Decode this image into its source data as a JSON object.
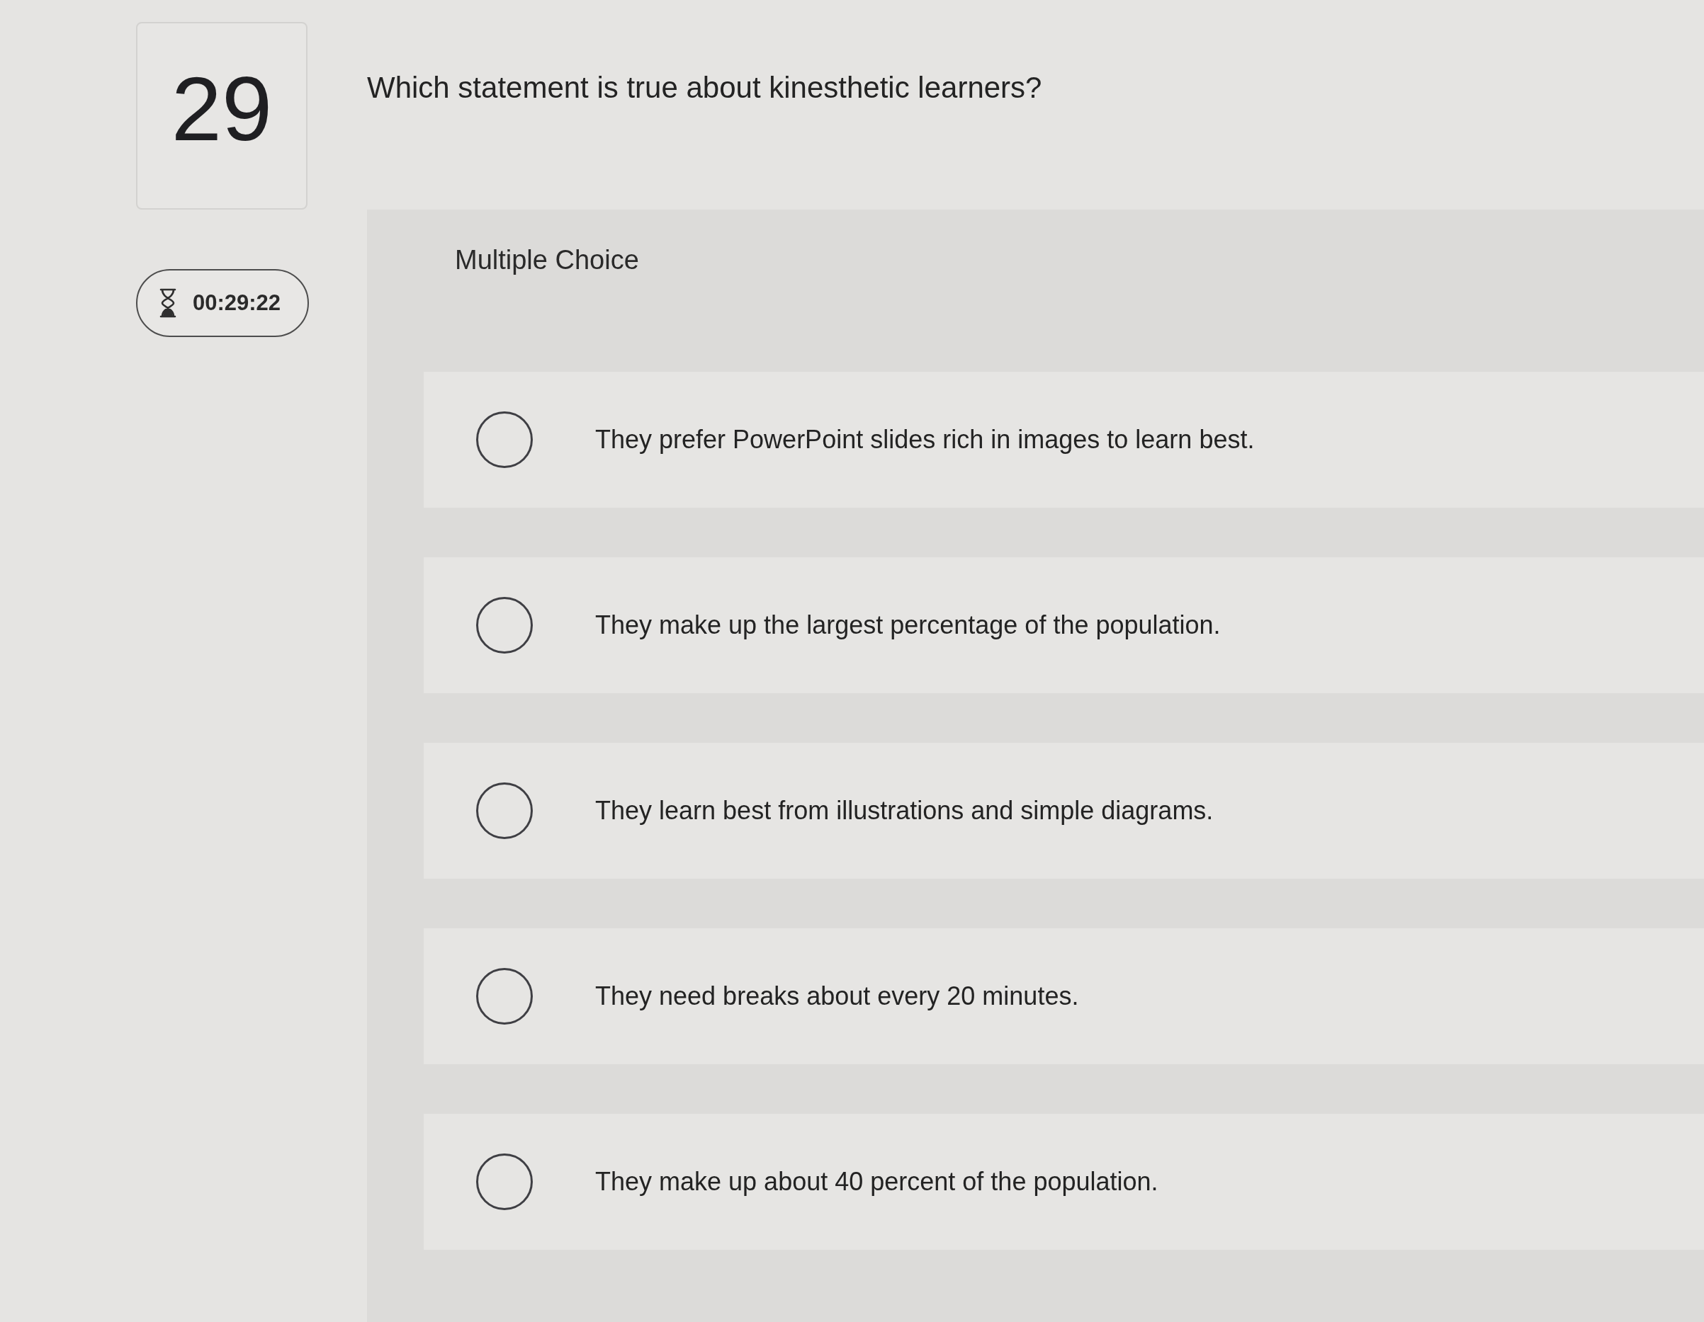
{
  "question": {
    "number": "29",
    "text": "Which statement is true about kinesthetic learners?"
  },
  "timer": {
    "time": "00:29:22"
  },
  "answer_panel": {
    "type_label": "Multiple Choice",
    "options": [
      {
        "text": "They prefer PowerPoint slides rich in images to learn best.",
        "selected": false
      },
      {
        "text": "They make up the largest percentage of the population.",
        "selected": false
      },
      {
        "text": "They learn best from illustrations and simple diagrams.",
        "selected": false
      },
      {
        "text": "They need breaks about every 20 minutes.",
        "selected": false
      },
      {
        "text": "They make up about 40 percent of the population.",
        "selected": false
      }
    ]
  }
}
